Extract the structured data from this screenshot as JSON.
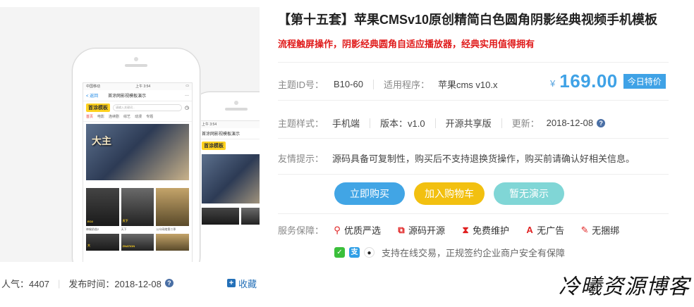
{
  "preview": {
    "phone_front": {
      "status_time": "上午 3:54",
      "carrier": "中国移动",
      "nav_back": "< 返回",
      "nav_title": "首涂网影视模板演示",
      "logo": "首涂模板",
      "search_placeholder": "请输入关键词...",
      "categories": [
        "首页",
        "电影",
        "连续剧",
        "综艺",
        "动漫",
        "专题"
      ],
      "banner_text": "大主",
      "posters": [
        "EO2",
        "天下",
        ""
      ],
      "poster_titles": [
        "神偷奶爸2",
        "天下",
        "公众网络第二季"
      ],
      "posters_row2": [
        "大",
        "ZNATION",
        ""
      ]
    },
    "phone_back": {
      "status_time": "上午 3:54",
      "nav_title": "首涂网影视模板演示",
      "logo": "首涂模板"
    }
  },
  "meta": {
    "popularity_label": "人气：",
    "popularity_value": "4407",
    "publish_label": "发布时间：",
    "publish_date": "2018-12-08",
    "favorite_label": "收藏"
  },
  "product": {
    "title": "【第十五套】苹果CMSv10原创精简白色圆角阴影经典视频手机模板",
    "subtitle": "流程触屏操作，阴影经典圆角自适应播放器，经典实用值得拥有",
    "theme_id_label": "主题ID号：",
    "theme_id": "B10-60",
    "program_label": "适用程序：",
    "program": "苹果cms v10.x",
    "currency": "¥",
    "price": "169.00",
    "deal_label": "今日特价",
    "style_label": "主题样式：",
    "style": "手机端",
    "version": "版本：v1.0",
    "license": "开源共享版",
    "update_label": "更新：",
    "update_date": "2018-12-08",
    "tip_label": "友情提示：",
    "tip": "源码具备可复制性，购买后不支持退换货操作，购买前请确认好相关信息。",
    "buttons": {
      "buy": "立即购买",
      "cart": "加入购物车",
      "demo": "暂无演示"
    },
    "service_label": "服务保障：",
    "services": [
      "优质严选",
      "源码开源",
      "免费维护",
      "无广告",
      "无捆绑"
    ],
    "pay_text": "支持在线交易，正规签约企业商户安全有保障"
  },
  "watermark": "冷曦资源博客"
}
